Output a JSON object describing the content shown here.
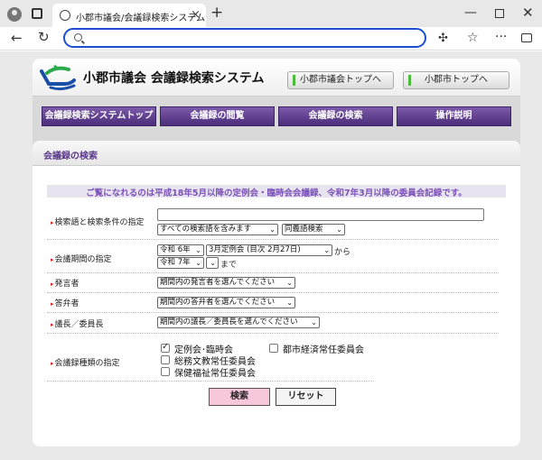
{
  "browser": {
    "tab_title": "小郡市議会/会議録検索システム",
    "address_value": ""
  },
  "header": {
    "site_title": "小郡市議会 会議録検索システム",
    "top_links": [
      "小郡市議会トップへ",
      "小郡市トップへ"
    ]
  },
  "nav": {
    "items": [
      "会議録検索システムトップ",
      "会議録の閲覧",
      "会議録の検索",
      "操作説明"
    ]
  },
  "section": {
    "title": "会議録の検索",
    "notice": "ご覧になれるのは平成18年5月以降の定例会・臨時会会議録、令和7年3月以降の委員会記録です。"
  },
  "form": {
    "keyword": {
      "label": "検索語と検索条件の指定",
      "value": "",
      "condition": "すべての検索語を含みます",
      "synonym": "同義語検索"
    },
    "period": {
      "label": "会議期間の指定",
      "from_era": "令和 6年",
      "from_session": "3月定例会 (目次 2月27日)",
      "from_suffix": "から",
      "to_era": "令和 7年",
      "to_session": "",
      "to_suffix": "まで"
    },
    "speaker": {
      "label": "発言者",
      "value": "期間内の発言者を選んでください"
    },
    "answerer": {
      "label": "答弁者",
      "value": "期間内の答弁者を選んでください"
    },
    "chair": {
      "label": "議長／委員長",
      "value": "期間内の議長／委員長を選んでください"
    },
    "types": {
      "label": "会議録種類の指定",
      "options": [
        {
          "label": "定例会･臨時会",
          "checked": true
        },
        {
          "label": "都市経済常任委員会",
          "checked": false
        },
        {
          "label": "総務文教常任委員会",
          "checked": false
        },
        {
          "label": "保健福祉常任委員会",
          "checked": false
        }
      ]
    },
    "search_button": "検索",
    "reset_button": "リセット"
  },
  "colors": {
    "accent_purple": "#5a3a8a",
    "notice_purple": "#7b51b8",
    "search_button_pink": "#f7c8db"
  }
}
